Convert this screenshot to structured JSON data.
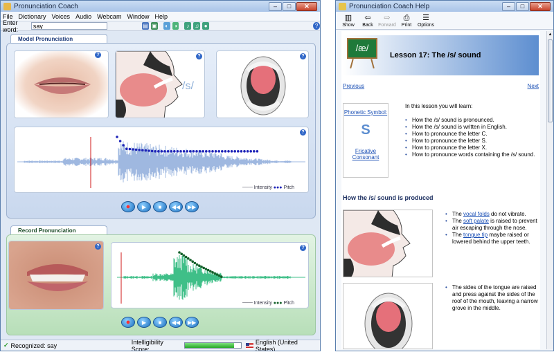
{
  "left_window": {
    "title": "Pronunciation Coach",
    "menu": [
      "File",
      "Dictionary",
      "Voices",
      "Audio",
      "Webcam",
      "Window",
      "Help"
    ],
    "enter_word_label": "Enter word:",
    "enter_word_value": "say",
    "model_panel": {
      "title": "Model Pronunciation",
      "symbol": "/s/",
      "legend_intensity": "Intensity",
      "legend_pitch": "Pitch"
    },
    "record_panel": {
      "title": "Record Pronunciation",
      "legend_intensity": "Intensity",
      "legend_pitch": "Pitch"
    },
    "status": {
      "recognized": "Recognized: say",
      "score_label": "Intelligibility Score:",
      "score_fraction": 0.88,
      "language": "English (United States)"
    }
  },
  "right_window": {
    "title": "Pronunciation Coach Help",
    "toolbar": [
      "Show",
      "Back",
      "Forward",
      "Print",
      "Options"
    ],
    "lesson": {
      "board_symbol": "/æ/",
      "title": "Lesson 17: The /s/ sound",
      "previous": "Previous",
      "next": "Next",
      "intro": "In this lesson you will learn:",
      "phonetic_label": "Phonetic Symbol:",
      "symbol": "S",
      "category": "Fricative Consonant",
      "learn_items": [
        "How the /s/ sound is pronounced.",
        "How the /s/ sound is written in English.",
        "How to pronounce the letter C.",
        "How to pronounce the letter S.",
        "How to pronounce the letter X.",
        "How to pronounce words containing the /s/ sound."
      ],
      "section_title": "How the /s/ sound is produced",
      "notes1": {
        "item1_pre": "The ",
        "item1_link": "vocal folds",
        "item1_post": " do not vibrate.",
        "item2_pre": "The ",
        "item2_link": "soft palate",
        "item2_post": " is raised to prevent air escaping through the nose.",
        "item3_pre": "The ",
        "item3_link": "tongue tip",
        "item3_post": " maybe raised or lowered behind the upper teeth."
      },
      "notes2": "The sides of the tongue are raised and press against the sides of the roof of the mouth, leaving a narrow grove in the middle."
    }
  },
  "colors": {
    "model_panel_bg": "#c9d8ee",
    "record_panel_bg": "#b8dfb9",
    "waveform_model": "#9fb8e0",
    "waveform_record": "#3fbf88",
    "pitch_model": "#1e24b8",
    "pitch_record": "#14602a",
    "cursor": "#d01818",
    "board_green": "#1f7a3a"
  }
}
